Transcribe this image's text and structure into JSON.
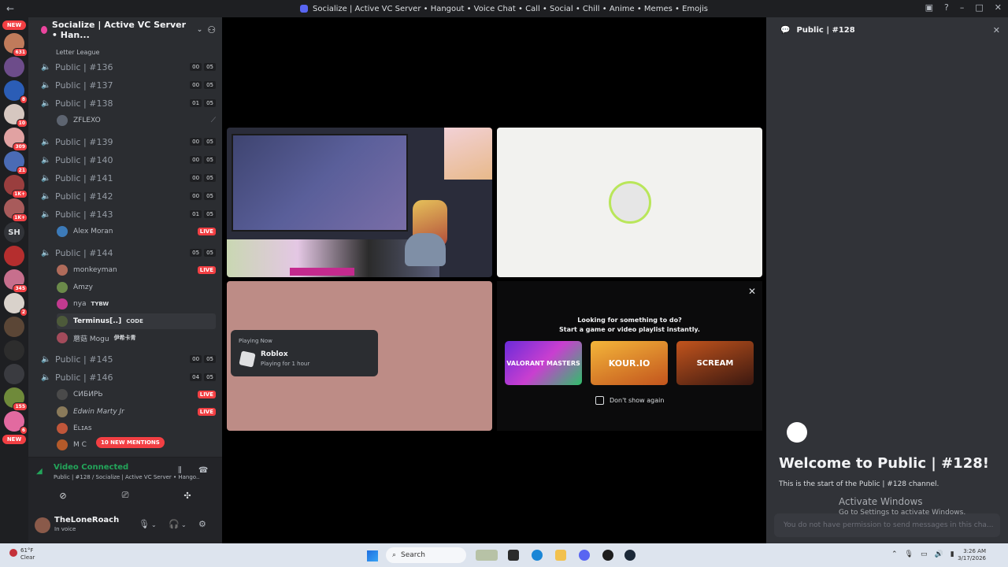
{
  "window": {
    "title": "Socialize | Active VC Server • Hangout • Voice Chat • Call • Social • Chill • Anime • Memes • Emojis"
  },
  "rail": {
    "new_top": "NEW",
    "new_bottom": "NEW",
    "sh_label": "SH",
    "badges": [
      "631",
      "8",
      "10",
      "309",
      "21",
      "1K+",
      "1K+",
      "345",
      "2",
      "155",
      "6"
    ]
  },
  "server": {
    "name": "Socialize | Active VC Server • Han...",
    "league": "Letter League"
  },
  "channels": [
    {
      "name": "Public | #136",
      "a": "00",
      "b": "05",
      "active": false
    },
    {
      "name": "Public | #137",
      "a": "00",
      "b": "05",
      "active": false
    },
    {
      "name": "Public | #138",
      "a": "01",
      "b": "05",
      "active": true
    },
    {
      "name": "Public | #139",
      "a": "00",
      "b": "05",
      "active": false
    },
    {
      "name": "Public | #140",
      "a": "00",
      "b": "05",
      "active": false
    },
    {
      "name": "Public | #141",
      "a": "00",
      "b": "05",
      "active": false
    },
    {
      "name": "Public | #142",
      "a": "00",
      "b": "05",
      "active": false
    },
    {
      "name": "Public | #143",
      "a": "01",
      "b": "05",
      "active": true
    },
    {
      "name": "Public | #144",
      "a": "05",
      "b": "05",
      "active": true
    },
    {
      "name": "Public | #145",
      "a": "00",
      "b": "05",
      "active": false
    },
    {
      "name": "Public | #146",
      "a": "04",
      "b": "05",
      "active": true
    }
  ],
  "users": {
    "zflexo": "ZFLEXO",
    "alex": "Alex Moran",
    "monkeyman": "monkeyman",
    "amzy": "Amzy",
    "nya": "nya",
    "nya_tag": "TYBW",
    "terminus": "Terminus[..]",
    "terminus_tag": "CODE",
    "mogu": "蘑菇 Mogu",
    "mogu_tag": "伊希卡青",
    "sibir": "СИБИРЬ",
    "edwin": "Edwin Marty Jr",
    "elias": "Eʟɪᴀs",
    "mc": "M C"
  },
  "live_label": "LIVE",
  "mentions": "10 NEW MENTIONS",
  "voice": {
    "status": "Video Connected",
    "location": "Public | #128 / Socialize | Active VC Server • Hango..."
  },
  "me": {
    "name": "TheLoneRoach",
    "status": "In voice"
  },
  "stage": {
    "playing_now": "Playing Now",
    "game": "Roblox",
    "duration": "Playing for 1 hour",
    "prompt_line1": "Looking for something to do?",
    "prompt_line2": "Start a game or video playlist instantly.",
    "card1": "VALORANT MASTERS",
    "card2": "KOUR.IO",
    "card3": "SCREAM",
    "dont_show": "Don't show again"
  },
  "chat": {
    "header": "Public | #128",
    "welcome": "Welcome to Public | #128!",
    "start": "This is the start of the Public | #128 channel.",
    "activate1": "Activate Windows",
    "activate2": "Go to Settings to activate Windows.",
    "no_permission": "You do not have permission to send messages in this cha..."
  },
  "taskbar": {
    "temp": "61°F",
    "condition": "Clear",
    "search": "Search",
    "time": "3:26 AM",
    "date": "3/17/2026"
  },
  "colors": {
    "accent_green": "#23a55a",
    "live_red": "#f23f43",
    "sidebar": "#2b2d31"
  }
}
